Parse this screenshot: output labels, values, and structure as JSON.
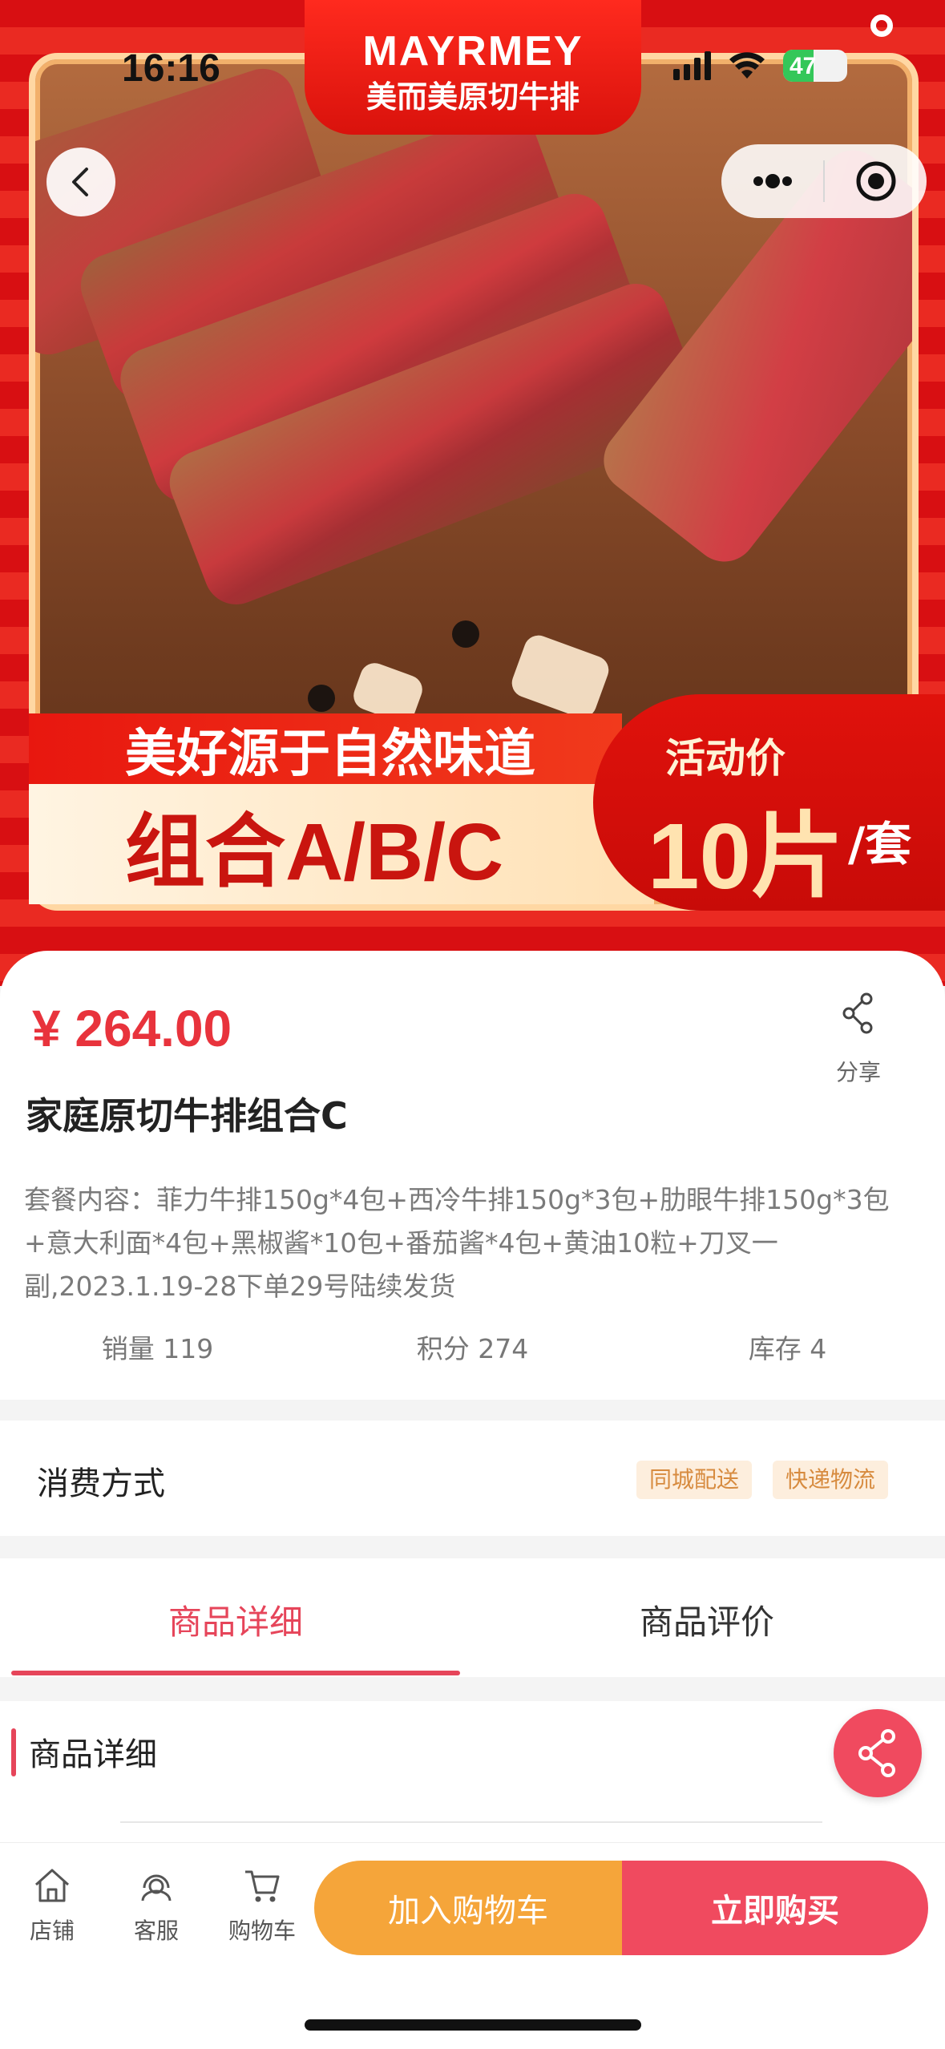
{
  "status_bar": {
    "time": "16:16",
    "battery": "47",
    "battery_level": 0.47
  },
  "brand": {
    "name_en": "MAYRMEY",
    "name_cn": "美而美原切牛排"
  },
  "hero": {
    "slogan": "美好源于自然味道",
    "combo": "组合A/B/C",
    "promo_label": "活动价",
    "promo_value": "10片",
    "promo_unit": "/套"
  },
  "product": {
    "price": "¥ 264.00",
    "share_label": "分享",
    "title": "家庭原切牛排组合C",
    "description": "套餐内容：菲力牛排150g*4包+西冷牛排150g*3包+肋眼牛排150g*3包+意大利面*4包+黑椒酱*10包+番茄酱*4包+黄油10粒+刀叉一副,2023.1.19-28下单29号陆续发货",
    "stats": [
      {
        "label": "销量 119"
      },
      {
        "label": "积分 274"
      },
      {
        "label": "库存 4"
      }
    ]
  },
  "consume": {
    "label": "消费方式",
    "tags": [
      "同城配送",
      "快递物流"
    ]
  },
  "tabs": [
    {
      "label": "商品详细",
      "active": true
    },
    {
      "label": "商品评价",
      "active": false
    }
  ],
  "detail": {
    "title": "商品详细"
  },
  "bottom_bar": {
    "nav": [
      {
        "label": "店铺",
        "icon": "home-icon"
      },
      {
        "label": "客服",
        "icon": "customer-service-icon"
      },
      {
        "label": "购物车",
        "icon": "cart-icon"
      }
    ],
    "add_to_cart": "加入购物车",
    "buy_now": "立即购买"
  },
  "colors": {
    "accent": "#e6455a",
    "price": "#e8333c",
    "cart_button": "#f5a53a",
    "buy_button": "#f04a5f"
  }
}
